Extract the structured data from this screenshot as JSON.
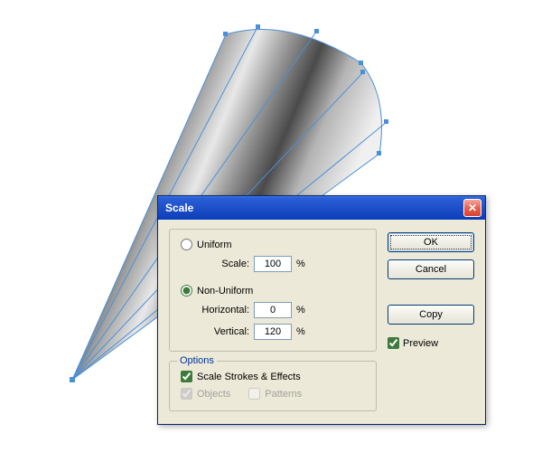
{
  "dialog": {
    "title": "Scale",
    "uniform": {
      "radio_label": "Uniform",
      "scale_label": "Scale:",
      "scale_value": "100",
      "scale_unit": "%"
    },
    "nonuniform": {
      "radio_label": "Non-Uniform",
      "horizontal_label": "Horizontal:",
      "horizontal_value": "0",
      "horizontal_unit": "%",
      "vertical_label": "Vertical:",
      "vertical_value": "120",
      "vertical_unit": "%"
    },
    "options": {
      "group_label": "Options",
      "scale_strokes_label": "Scale Strokes & Effects",
      "objects_label": "Objects",
      "patterns_label": "Patterns"
    },
    "buttons": {
      "ok": "OK",
      "cancel": "Cancel",
      "copy": "Copy",
      "preview": "Preview"
    }
  }
}
